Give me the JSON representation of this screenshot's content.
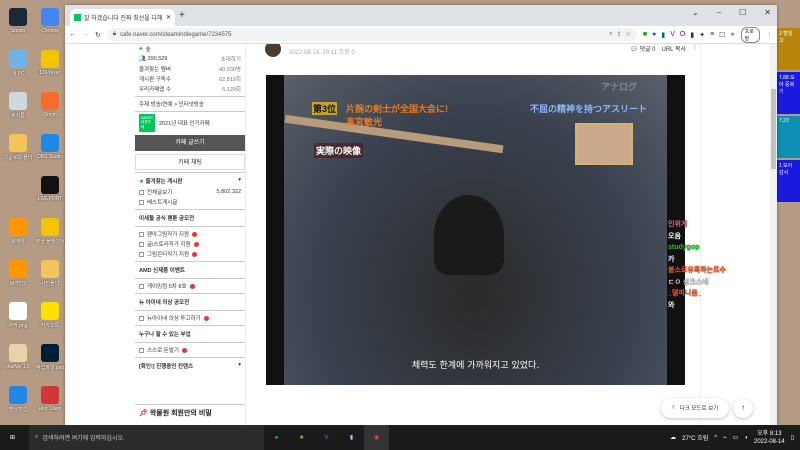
{
  "desktop": {
    "left_icons": [
      {
        "label": "Steam",
        "color": "#1b2838"
      },
      {
        "label": "Chrome",
        "color": "#4285f4"
      },
      {
        "label": "내 PC",
        "color": "#6fb3e8"
      },
      {
        "label": "LDPlayer",
        "color": "#f5c400"
      },
      {
        "label": "휴지통",
        "color": "#cfd8dc"
      },
      {
        "label": "Origin",
        "color": "#f56c2d"
      },
      {
        "label": "다운로드 폴더",
        "color": "#f2c45a"
      },
      {
        "label": "OBS Studio",
        "color": "#1e88e5"
      },
      {
        "label": "",
        "color": "#b59b83"
      },
      {
        "label": "LIVEPORT",
        "color": "#111111"
      },
      {
        "label": "M게임",
        "color": "#ff9800"
      },
      {
        "label": "영상 플레이어",
        "color": "#f5c400"
      },
      {
        "label": "M게임2",
        "color": "#ff9800"
      },
      {
        "label": "사진폴더",
        "color": "#f2c45a"
      },
      {
        "label": "자막.png",
        "color": "#ffffff"
      },
      {
        "label": "카카오톡",
        "color": "#fae100"
      },
      {
        "label": "mulMe 1.0",
        "color": "#e8d3a8"
      },
      {
        "label": "작업파일.psd",
        "color": "#001e36"
      },
      {
        "label": "영상편집",
        "color": "#1e88e5"
      },
      {
        "label": "Riot Client",
        "color": "#d13639"
      }
    ]
  },
  "browser": {
    "tab_title": "잘 하겠습니다 진짜 최선을 다해",
    "url": "cafe.naver.com/steamindiegame/7234575",
    "profile": "프로필",
    "window_controls": [
      "⌄",
      "–",
      "☐",
      "✕"
    ]
  },
  "sidebar": {
    "cafe_level": "숲",
    "members": "390,529",
    "invite": "초대하기",
    "stats": [
      {
        "label": "즐겨찾는 멤버",
        "value": "40,930명"
      },
      {
        "label": "게시판 구독수",
        "value": "62,819회"
      },
      {
        "label": "우리카페앱 수",
        "value": "6,129회"
      }
    ],
    "topic": "주제  방송/연예 > 인터넷방송",
    "badge": "NAVER 대표카페",
    "award": "2021년 대표 인기카페",
    "write_button": "카페 글쓰기",
    "chat_button": "카페 채팅",
    "fav_header": "즐겨찾는 게시판",
    "fav_items": [
      {
        "label": "전체글보기",
        "count": "5,802,322"
      },
      {
        "label": "베스트게시글",
        "count": ""
      }
    ],
    "sections": [
      {
        "title": "이세돌 공식 팬툰 공모전",
        "items": [
          "팬아그림작가 지원",
          "글/스토리작가 지원",
          "그림콘티작가 지원"
        ]
      },
      {
        "title": "AMD 신제품 이벤트",
        "items": [
          "게이밍컴 5차 8호"
        ]
      },
      {
        "title": "뉴 아이네 의상 공모전",
        "items": [
          "뉴아이네 의상 투고하기"
        ]
      },
      {
        "title": "누구나 할 수 있는 부업",
        "items": [
          "스스로 돈벌기"
        ]
      }
    ],
    "ongoing": "[확인!] 진행중인 컨텐츠",
    "pinned": "왁물원 회원만의 비밀"
  },
  "post": {
    "date": "2022.08.14. 20:11",
    "views": "조회 0",
    "comments": "댓글 0",
    "url_copy": "URL 복사",
    "video": {
      "rank": "第3位",
      "headline": "片腕の剣士が全国大会に!",
      "name": "高宮敏光",
      "tag": "実際の映像",
      "right_caption": "不屈の精神を持つアスリート",
      "logo": "アナログ",
      "subtitle": "체력도 한계에 가까워지고 있었다."
    }
  },
  "chat": [
    {
      "text": "인위게",
      "color": "#e06a9a"
    },
    {
      "text": "오음",
      "color": "#ffffff"
    },
    {
      "text": "studygop",
      "color": "#22cc22"
    },
    {
      "text": "카",
      "color": "#ffffff"
    },
    {
      "text": "불소로유혹하는트수",
      "color": "#ff5a1f"
    },
    {
      "text": "ㄷㅇ 싱크스네",
      "color": "#dddddd"
    },
    {
      "text": "_델피니움_",
      "color": "#ff5a1f"
    },
    {
      "text": "와",
      "color": "#ffffff"
    }
  ],
  "floating": {
    "dark_mode": "다크 모드로 보기",
    "top": "↑"
  },
  "right_panel": [
    {
      "text": "3 할일 고",
      "color": "#b8860b"
    },
    {
      "text": "7.88 모아 중복기",
      "color": "#1a1adf"
    },
    {
      "text": "7.23",
      "color": "#0c8fb3"
    },
    {
      "text": "1 모아 감사",
      "color": "#1a1adf"
    }
  ],
  "taskbar": {
    "search_placeholder": "검색하려면 여기에 입력하십시오.",
    "weather": "27°C 흐림",
    "time": "오후 8:13",
    "date": "2022-08-14"
  }
}
